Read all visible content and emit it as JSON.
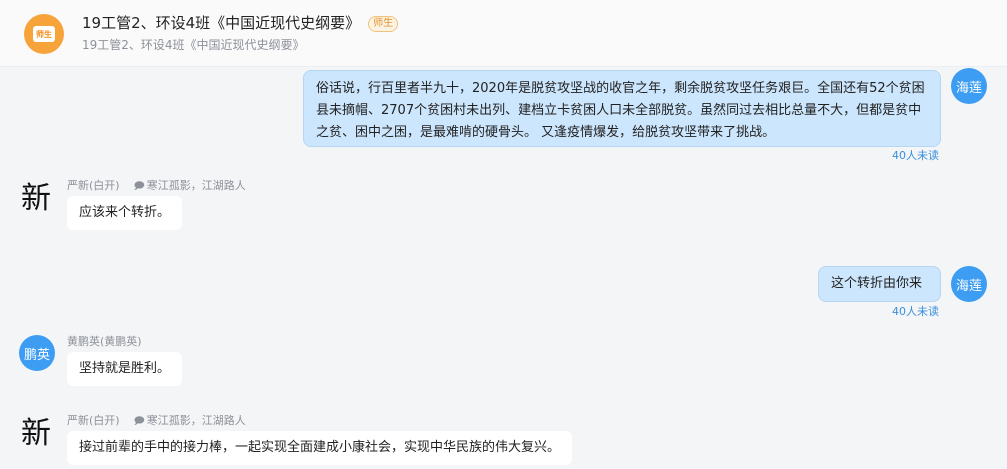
{
  "header": {
    "avatar_label": "师生",
    "title": "19工管2、环设4班《中国近现代史纲要》",
    "badge": "师生",
    "subtitle": "19工管2、环设4班《中国近现代史纲要》"
  },
  "messages": [
    {
      "side": "right",
      "avatar": "海莲",
      "text": "俗话说，行百里者半九十，2020年是脱贫攻坚战的收官之年，剩余脱贫攻坚任务艰巨。全国还有52个贫困县未摘帽、2707个贫困村未出列、建档立卡贫困人口未全部脱贫。虽然同过去相比总量不大，但都是贫中之贫、困中之困，是最难啃的硬骨头。      又逢疫情爆发，给脱贫攻坚带来了挑战。",
      "unread": "40人未读"
    },
    {
      "side": "left",
      "avatar_char": "新",
      "sender": "严新(白开)",
      "tags": "寒江孤影，江湖路人",
      "text": "应该来个转折。"
    },
    {
      "side": "right",
      "avatar": "海莲",
      "text": "这个转折由你来",
      "unread": "40人未读"
    },
    {
      "side": "left",
      "avatar": "鹏英",
      "sender": "黄鹏英(黄鹏英)",
      "text": "坚持就是胜利。"
    },
    {
      "side": "left",
      "avatar_char": "新",
      "sender": "严新(白开)",
      "tags": "寒江孤影，江湖路人",
      "text": "接过前辈的手中的接力棒，一起实现全面建成小康社会，实现中华民族的伟大复兴。"
    }
  ]
}
